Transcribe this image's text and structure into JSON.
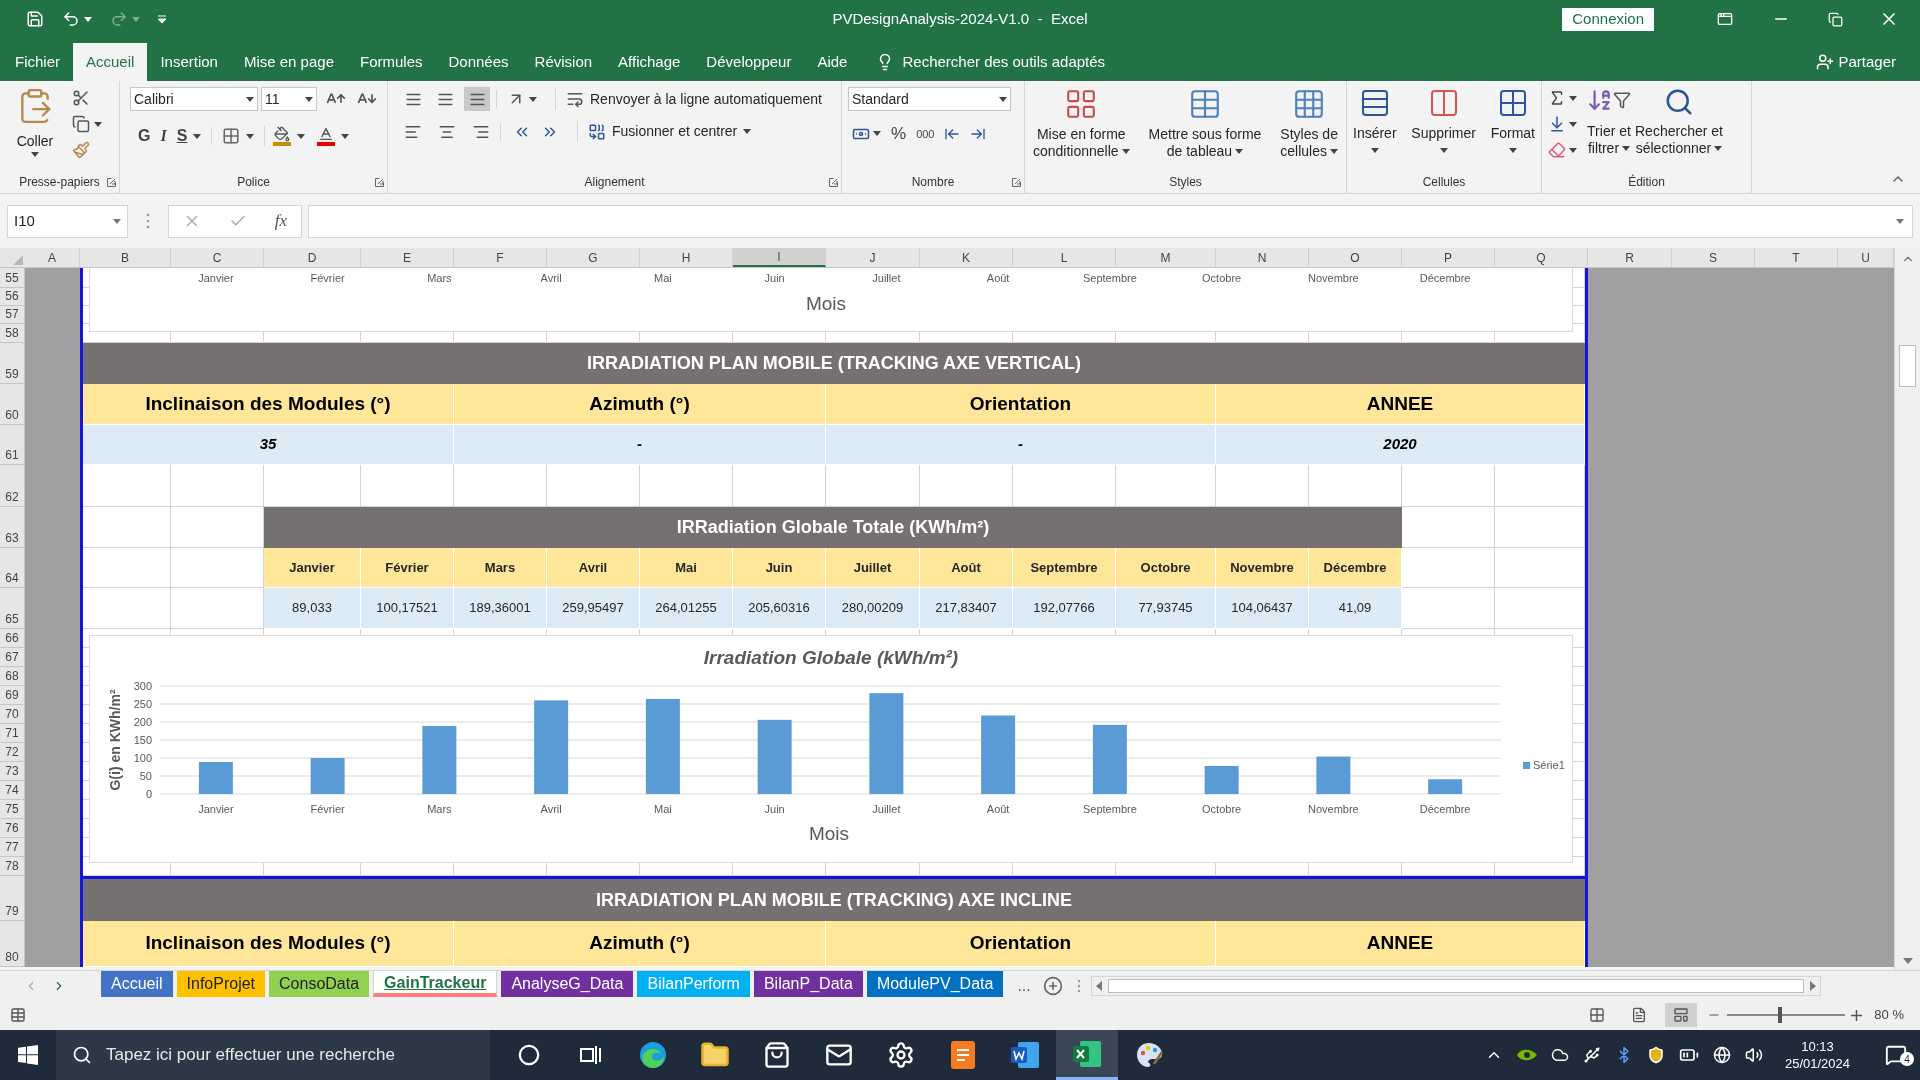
{
  "title_bar": {
    "title": "PVDesignAnalysis-2024-V1.0  -  Excel",
    "sign_in_button": "Connexion"
  },
  "ribbon_tabs": [
    {
      "label": "Fichier",
      "selected": false
    },
    {
      "label": "Accueil",
      "selected": true
    },
    {
      "label": "Insertion",
      "selected": false
    },
    {
      "label": "Mise en page",
      "selected": false
    },
    {
      "label": "Formules",
      "selected": false
    },
    {
      "label": "Données",
      "selected": false
    },
    {
      "label": "Révision",
      "selected": false
    },
    {
      "label": "Affichage",
      "selected": false
    },
    {
      "label": "Développeur",
      "selected": false
    },
    {
      "label": "Aide",
      "selected": false
    }
  ],
  "tell_me": "Rechercher des outils adaptés",
  "share_button": "Partager",
  "clipboard": {
    "paste_label": "Coller",
    "group_label": "Presse-papiers"
  },
  "font": {
    "name": "Calibri",
    "size": "11",
    "bold": "G",
    "italic": "I",
    "underline": "S",
    "group_label": "Police"
  },
  "alignment": {
    "vertical_align": [
      {
        "selected": false
      },
      {
        "selected": false
      },
      {
        "selected": true
      }
    ],
    "wrap_text": "Renvoyer à la ligne automatiquement",
    "merge_center": "Fusionner et centrer",
    "group_label": "Alignement"
  },
  "number": {
    "format": "Standard",
    "percent": "%",
    "thousands": "000",
    "group_label": "Nombre"
  },
  "styles": {
    "buttons": [
      {
        "kind": "conditional",
        "lines": [
          "Mise en forme",
          "conditionnelle"
        ]
      },
      {
        "kind": "table",
        "lines": [
          "Mettre sous forme",
          "de tableau"
        ]
      },
      {
        "kind": "cell_styles",
        "lines": [
          "Styles de",
          "cellules"
        ]
      }
    ],
    "group_label": "Styles"
  },
  "cells": {
    "buttons": [
      {
        "kind": "insert",
        "label": "Insérer"
      },
      {
        "kind": "delete",
        "label": "Supprimer"
      },
      {
        "kind": "format",
        "label": "Format"
      }
    ],
    "group_label": "Cellules"
  },
  "editing": {
    "sort_filter": [
      "Trier et",
      "filtrer"
    ],
    "find_select": [
      "Rechercher et",
      "sélectionner"
    ],
    "group_label": "Édition"
  },
  "formula_bar": {
    "name_box": "I10",
    "function_label": "fx"
  },
  "columns": [
    {
      "label": "A",
      "selected": false
    },
    {
      "label": "B",
      "selected": false
    },
    {
      "label": "C",
      "selected": false
    },
    {
      "label": "D",
      "selected": false
    },
    {
      "label": "E",
      "selected": false
    },
    {
      "label": "F",
      "selected": false
    },
    {
      "label": "G",
      "selected": false
    },
    {
      "label": "H",
      "selected": false
    },
    {
      "label": "I",
      "selected": true
    },
    {
      "label": "J",
      "selected": false
    },
    {
      "label": "K",
      "selected": false
    },
    {
      "label": "L",
      "selected": false
    },
    {
      "label": "M",
      "selected": false
    },
    {
      "label": "N",
      "selected": false
    },
    {
      "label": "O",
      "selected": false
    },
    {
      "label": "P",
      "selected": false
    },
    {
      "label": "Q",
      "selected": false
    },
    {
      "label": "R",
      "selected": false
    },
    {
      "label": "S",
      "selected": false
    },
    {
      "label": "T",
      "selected": false
    },
    {
      "label": "U",
      "selected": false
    }
  ],
  "rows": [
    "55",
    "56",
    "57",
    "58",
    "59",
    "60",
    "61",
    "62",
    "63",
    "64",
    "65",
    "66",
    "67",
    "68",
    "69",
    "70",
    "71",
    "72",
    "73",
    "74",
    "75",
    "76",
    "77",
    "78",
    "79",
    "80"
  ],
  "top_chart_fragment": {
    "categories": [
      "Janvier",
      "Février",
      "Mars",
      "Avril",
      "Mai",
      "Juin",
      "Juillet",
      "Août",
      "Septembre",
      "Octobre",
      "Novembre",
      "Décembre"
    ],
    "xlabel": "Mois"
  },
  "section_vertical": {
    "title": "IRRADIATION PLAN MOBILE (TRACKING AXE VERTICAL)",
    "headers": [
      "Inclinaison des Modules (°)",
      "Azimuth (°)",
      "Orientation",
      "ANNEE"
    ],
    "values": [
      "35",
      "-",
      "-",
      "2020"
    ]
  },
  "irradiation_table": {
    "title": "IRRadiation Globale Totale (KWh/m²)",
    "months": [
      "Janvier",
      "Février",
      "Mars",
      "Avril",
      "Mai",
      "Juin",
      "Juillet",
      "Août",
      "Septembre",
      "Octobre",
      "Novembre",
      "Décembre"
    ],
    "values": [
      "89,033",
      "100,17521",
      "189,36001",
      "259,95497",
      "264,01255",
      "205,60316",
      "280,00209",
      "217,83407",
      "192,07766",
      "77,93745",
      "104,06437",
      "41,09"
    ]
  },
  "irradiation_chart": {
    "chart_data": {
      "type": "bar",
      "title": "Irradiation Globale (kWh/m²)",
      "xlabel": "Mois",
      "ylabel": "G(i) en KWh/m²",
      "categories": [
        "Janvier",
        "Février",
        "Mars",
        "Avril",
        "Mai",
        "Juin",
        "Juillet",
        "Août",
        "Septembre",
        "Octobre",
        "Novembre",
        "Décembre"
      ],
      "series": [
        {
          "name": "Série1",
          "color": "#5b9bd5",
          "values": [
            89,
            100,
            189,
            260,
            264,
            206,
            280,
            218,
            192,
            78,
            104,
            41
          ]
        }
      ],
      "grid": true,
      "ylim": [
        0,
        300
      ],
      "yticks": [
        0,
        50,
        100,
        150,
        200,
        250,
        300
      ]
    }
  },
  "section_inclined": {
    "title": "IRRADIATION PLAN MOBILE (TRACKING) AXE INCLINE",
    "headers": [
      "Inclinaison des Modules (°)",
      "Azimuth (°)",
      "Orientation",
      "ANNEE"
    ]
  },
  "sheet_tabs": [
    {
      "label": "Accueil",
      "color": "#4472c4",
      "selected": false
    },
    {
      "label": "InfoProjet",
      "color": "#ffc000",
      "selected": false
    },
    {
      "label": "ConsoData",
      "color": "#92d050",
      "selected": false
    },
    {
      "label": "GainTrackeur",
      "color": "#ff7c80",
      "selected": true
    },
    {
      "label": "AnalyseG_Data",
      "color": "#7030a0",
      "selected": false
    },
    {
      "label": "BilanPerform",
      "color": "#00b0f0",
      "selected": false
    },
    {
      "label": "BilanP_Data",
      "color": "#7030a0",
      "selected": false
    },
    {
      "label": "ModulePV_Data",
      "color": "#0070c0",
      "selected": false
    }
  ],
  "more_tabs": "...",
  "status_bar": {
    "views": [
      {
        "kind": "normal",
        "selected": false
      },
      {
        "kind": "page_layout",
        "selected": false
      },
      {
        "kind": "page_break",
        "selected": true
      }
    ],
    "zoom_slider": {
      "level": 0.45
    },
    "zoom": "80 %"
  },
  "taskbar": {
    "search_placeholder": "Tapez ici pour effectuer une recherche",
    "apps": [
      {
        "kind": "cortana",
        "selected": false
      },
      {
        "kind": "taskview",
        "selected": false
      },
      {
        "kind": "edge",
        "selected": false
      },
      {
        "kind": "explorer",
        "selected": false
      },
      {
        "kind": "store",
        "selected": false
      },
      {
        "kind": "mail",
        "selected": false
      },
      {
        "kind": "settings",
        "selected": false
      },
      {
        "kind": "pdf",
        "selected": false
      },
      {
        "kind": "word",
        "selected": false
      },
      {
        "kind": "excel",
        "selected": true
      },
      {
        "kind": "paint",
        "selected": false
      }
    ],
    "time": "10:13",
    "date": "25/01/2024",
    "notifications": "4"
  }
}
